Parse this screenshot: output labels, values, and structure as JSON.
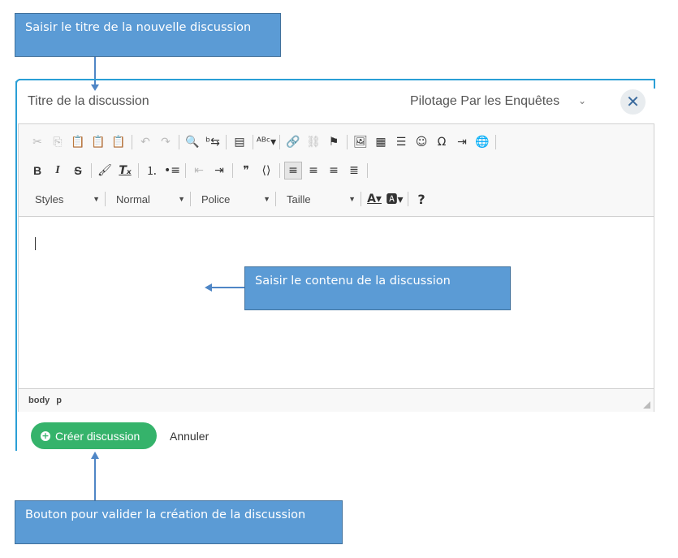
{
  "annotations": {
    "title_hint": "Saisir le titre de la nouvelle discussion",
    "content_hint": "Saisir le contenu de la discussion",
    "button_hint": "Bouton pour valider la création de la discussion"
  },
  "dialog": {
    "title_placeholder": "Titre de la discussion",
    "forum_select_value": "Pilotage Par les Enquêtes",
    "close_label": "✕"
  },
  "toolbar": {
    "row1": [
      {
        "name": "cut-icon",
        "glyph": "✂",
        "disabled": true
      },
      {
        "name": "copy-icon",
        "glyph": "⎘",
        "disabled": true
      },
      {
        "name": "paste-icon",
        "glyph": "📋",
        "disabled": false
      },
      {
        "name": "paste-text-icon",
        "glyph": "📋",
        "disabled": false
      },
      {
        "name": "paste-word-icon",
        "glyph": "📋",
        "disabled": false
      },
      {
        "sep": true
      },
      {
        "name": "undo-icon",
        "glyph": "↶",
        "disabled": true
      },
      {
        "name": "redo-icon",
        "glyph": "↷",
        "disabled": true
      },
      {
        "sep": true
      },
      {
        "name": "find-icon",
        "glyph": "🔍",
        "disabled": false
      },
      {
        "name": "replace-icon",
        "glyph": "ᵇ⇆",
        "disabled": false
      },
      {
        "sep": true
      },
      {
        "name": "select-all-icon",
        "glyph": "▤",
        "disabled": false
      },
      {
        "sep": true
      },
      {
        "name": "spellcheck-icon",
        "glyph": "ᴬᴮᶜ▾",
        "disabled": false
      },
      {
        "sep": true
      },
      {
        "name": "link-icon",
        "glyph": "🔗",
        "disabled": false
      },
      {
        "name": "unlink-icon",
        "glyph": "⛓",
        "disabled": true
      },
      {
        "name": "anchor-icon",
        "glyph": "⚑",
        "disabled": false
      },
      {
        "sep": true
      },
      {
        "name": "image-icon",
        "glyph": "🖼",
        "disabled": false
      },
      {
        "name": "table-icon",
        "glyph": "▦",
        "disabled": false
      },
      {
        "name": "horizontal-rule-icon",
        "glyph": "☰",
        "disabled": false
      },
      {
        "name": "smiley-icon",
        "glyph": "☺",
        "disabled": false
      },
      {
        "name": "special-char-icon",
        "glyph": "Ω",
        "disabled": false
      },
      {
        "name": "page-break-icon",
        "glyph": "⇥",
        "disabled": false
      },
      {
        "name": "iframe-icon",
        "glyph": "🌐",
        "disabled": false
      },
      {
        "sep": true
      }
    ],
    "row2": [
      {
        "name": "bold-icon",
        "glyph": "B",
        "disabled": false,
        "style": "font-weight:bold;font-family:'Liberation Sans',sans-serif"
      },
      {
        "name": "italic-icon",
        "glyph": "I",
        "disabled": false,
        "style": "font-style:italic;font-weight:bold;font-family:'Liberation Serif',serif"
      },
      {
        "name": "strike-icon",
        "glyph": "S",
        "disabled": false,
        "style": "text-decoration:line-through;font-weight:bold;font-family:'Liberation Sans',sans-serif"
      },
      {
        "sep": true
      },
      {
        "name": "copy-format-icon",
        "glyph": "🖌",
        "disabled": false
      },
      {
        "name": "remove-format-icon",
        "glyph": "Tₓ",
        "disabled": false,
        "style": "font-style:italic;font-weight:bold;text-decoration:underline"
      },
      {
        "sep": true
      },
      {
        "name": "numbered-list-icon",
        "glyph": "⒈",
        "disabled": false
      },
      {
        "name": "bulleted-list-icon",
        "glyph": "•≡",
        "disabled": false
      },
      {
        "sep": true
      },
      {
        "name": "outdent-icon",
        "glyph": "⇤",
        "disabled": true
      },
      {
        "name": "indent-icon",
        "glyph": "⇥",
        "disabled": false
      },
      {
        "sep": true
      },
      {
        "name": "blockquote-icon",
        "glyph": "❞",
        "disabled": false
      },
      {
        "name": "div-container-icon",
        "glyph": "⟨⟩",
        "disabled": false
      },
      {
        "sep": true
      },
      {
        "name": "align-left-icon",
        "glyph": "≡",
        "disabled": false,
        "active": true
      },
      {
        "name": "align-center-icon",
        "glyph": "≡",
        "disabled": false
      },
      {
        "name": "align-right-icon",
        "glyph": "≡",
        "disabled": false
      },
      {
        "name": "align-justify-icon",
        "glyph": "≣",
        "disabled": false
      },
      {
        "sep": true
      }
    ],
    "combos": [
      {
        "name": "styles-combo",
        "label": "Styles",
        "width": 92
      },
      {
        "name": "format-combo",
        "label": "Normal",
        "width": 97
      },
      {
        "name": "font-combo",
        "label": "Police",
        "width": 97
      },
      {
        "name": "size-combo",
        "label": "Taille",
        "width": 97
      }
    ],
    "row3_tail": [
      {
        "name": "text-color-icon",
        "glyph": "A▾",
        "disabled": false,
        "style": "text-decoration:underline;font-weight:bold"
      },
      {
        "name": "bg-color-icon",
        "glyph": "🅰▾",
        "disabled": false
      },
      {
        "sep": true
      },
      {
        "name": "help-icon",
        "glyph": "?",
        "disabled": false,
        "style": "font-weight:bold;font-size:16px"
      }
    ]
  },
  "statusbar": {
    "path": [
      "body",
      "p"
    ]
  },
  "actions": {
    "create_label": "Créer discussion",
    "cancel_label": "Annuler"
  }
}
